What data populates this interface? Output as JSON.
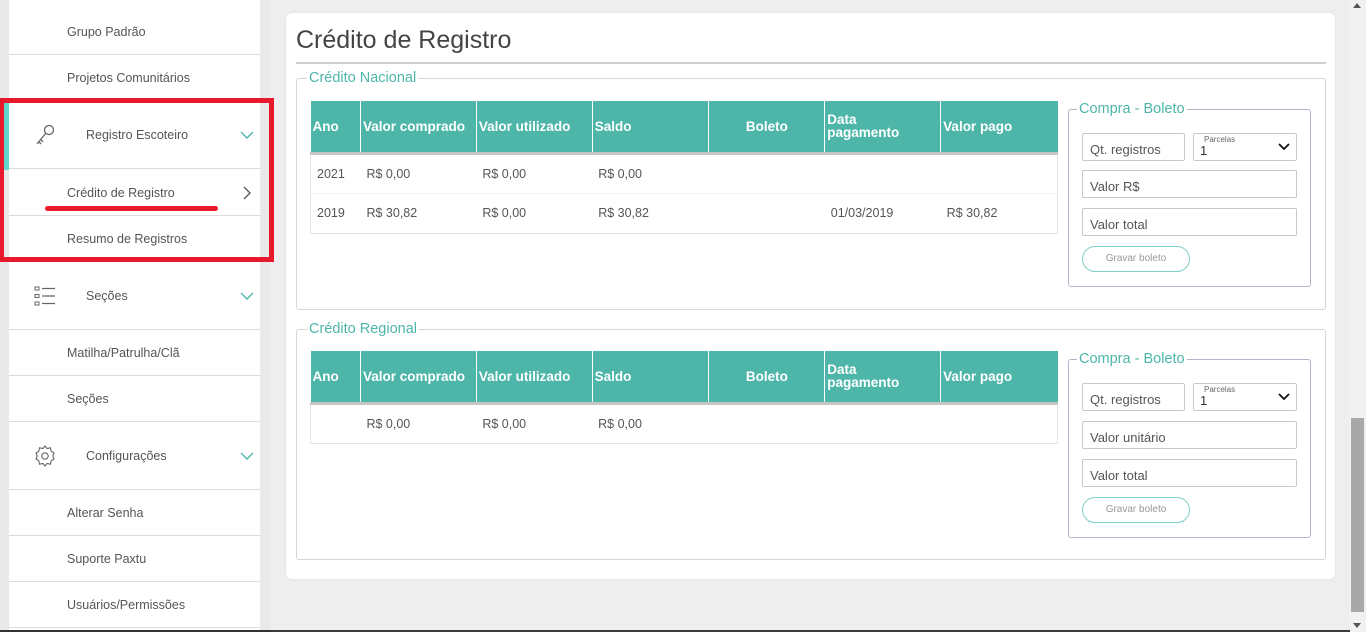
{
  "sidebar": {
    "items": {
      "grupo_padrao": "Grupo Padrão",
      "projetos_comunitarios": "Projetos Comunitários",
      "registro_escoteiro": "Registro Escoteiro",
      "credito_de_registro": "Crédito de Registro",
      "resumo_de_registros": "Resumo de Registros",
      "secoes_group": "Seções",
      "matilha": "Matilha/Patrulha/Clã",
      "secoes": "Seções",
      "configuracoes": "Configurações",
      "alterar_senha": "Alterar Senha",
      "suporte": "Suporte Paxtu",
      "usuarios": "Usuários/Permissões"
    }
  },
  "main": {
    "title": "Crédito de Registro",
    "nacional": {
      "legend": "Crédito Nacional",
      "columns": {
        "ano": "Ano",
        "valor_comprado": "Valor comprado",
        "valor_utilizado": "Valor utilizado",
        "saldo": "Saldo",
        "boleto": "Boleto",
        "data_pagamento_1": "Data",
        "data_pagamento_2": "pagamento",
        "valor_pago": "Valor pago"
      },
      "rows": [
        {
          "ano": "2021",
          "comprado": "R$ 0,00",
          "utilizado": "R$ 0,00",
          "saldo": "R$ 0,00",
          "boleto": "",
          "data": "",
          "pago": ""
        },
        {
          "ano": "2019",
          "comprado": "R$ 30,82",
          "utilizado": "R$ 0,00",
          "saldo": "R$ 30,82",
          "boleto": "",
          "data": "01/03/2019",
          "pago": "R$ 30,82"
        }
      ],
      "buy": {
        "legend": "Compra - Boleto",
        "qt_placeholder": "Qt. registros",
        "parcelas_label": "Parcelas",
        "parcelas_value": "1",
        "valor_placeholder": "Valor R$",
        "total_placeholder": "Valor total",
        "button": "Gravar boleto"
      }
    },
    "regional": {
      "legend": "Crédito Regional",
      "columns": {
        "ano": "Ano",
        "valor_comprado": "Valor comprado",
        "valor_utilizado": "Valor utilizado",
        "saldo": "Saldo",
        "boleto": "Boleto",
        "data_pagamento_1": "Data",
        "data_pagamento_2": "pagamento",
        "valor_pago": "Valor pago"
      },
      "rows": [
        {
          "ano": "",
          "comprado": "R$ 0,00",
          "utilizado": "R$ 0,00",
          "saldo": "R$ 0,00",
          "boleto": "",
          "data": "",
          "pago": ""
        }
      ],
      "buy": {
        "legend": "Compra - Boleto",
        "qt_placeholder": "Qt. registros",
        "parcelas_label": "Parcelas",
        "parcelas_value": "1",
        "valor_placeholder": "Valor unitário",
        "total_placeholder": "Valor total",
        "button": "Gravar boleto"
      }
    }
  },
  "colors": {
    "accent": "#4db6a8",
    "highlight_red": "#e8192c",
    "active_bar": "#5fd6cb"
  }
}
